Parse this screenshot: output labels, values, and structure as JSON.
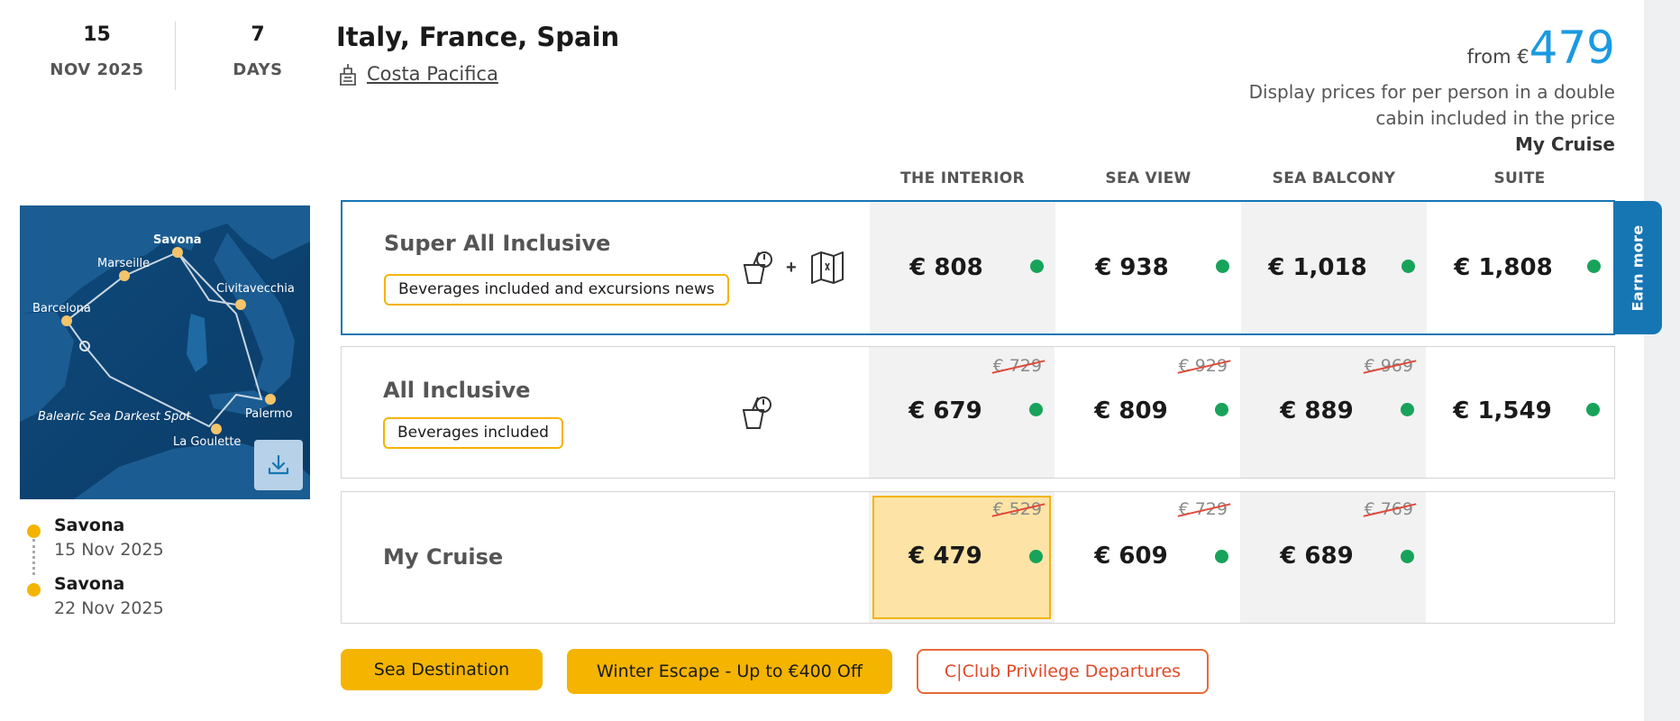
{
  "header": {
    "date_day": "15",
    "date_month_year": "NOV 2025",
    "days_count": "7",
    "days_label": "DAYS",
    "route_title": "Italy, France, Spain",
    "ship_name": "Costa Pacifica",
    "ship_icon": "ship-icon",
    "from_label": "from €",
    "from_price": "479",
    "price_note": "Display prices for per person in a double cabin included in the price",
    "price_note_fare": "My Cruise"
  },
  "map": {
    "labels": [
      "Savona",
      "Marseille",
      "Civitavecchia",
      "Barcelona",
      "Palermo",
      "Balearic Sea Darkest Spot",
      "La Goulette"
    ],
    "download_icon": "download-icon"
  },
  "itinerary": [
    {
      "port": "Savona",
      "date": "15 Nov 2025"
    },
    {
      "port": "Savona",
      "date": "22 Nov 2025"
    }
  ],
  "columns": [
    "THE INTERIOR",
    "SEA VIEW",
    "SEA BALCONY",
    "SUITE"
  ],
  "fares": [
    {
      "name": "Super All Inclusive",
      "tag": "Beverages included and excursions news",
      "icons": [
        "drinks-icon",
        "plus-icon",
        "map-icon"
      ],
      "plus": "+",
      "prices": [
        {
          "old": "",
          "price": "€ 808"
        },
        {
          "old": "",
          "price": "€ 938"
        },
        {
          "old": "",
          "price": "€ 1,018"
        },
        {
          "old": "",
          "price": "€ 1,808"
        }
      ]
    },
    {
      "name": "All Inclusive",
      "tag": "Beverages included",
      "icons": [
        "drinks-icon"
      ],
      "prices": [
        {
          "old": "€ 729",
          "price": "€ 679"
        },
        {
          "old": "€ 929",
          "price": "€ 809"
        },
        {
          "old": "€ 969",
          "price": "€ 889"
        },
        {
          "old": "",
          "price": "€ 1,549"
        }
      ]
    },
    {
      "name": "My Cruise",
      "tag": "",
      "icons": [],
      "prices": [
        {
          "old": "€ 529",
          "price": "€ 479",
          "selected": true
        },
        {
          "old": "€ 729",
          "price": "€ 609"
        },
        {
          "old": "€ 769",
          "price": "€ 689"
        },
        {
          "old": "",
          "price": ""
        }
      ]
    }
  ],
  "earn_more": "Earn more",
  "promos": [
    "Sea Destination",
    "Winter Escape - Up to €400 Off",
    "C|Club Privilege Departures"
  ],
  "colors": {
    "accent_blue": "#1676b4",
    "price_blue": "#1a9ae0",
    "yellow": "#f4b400",
    "available_green": "#18a35a",
    "promo_outline": "#e76a3a"
  }
}
